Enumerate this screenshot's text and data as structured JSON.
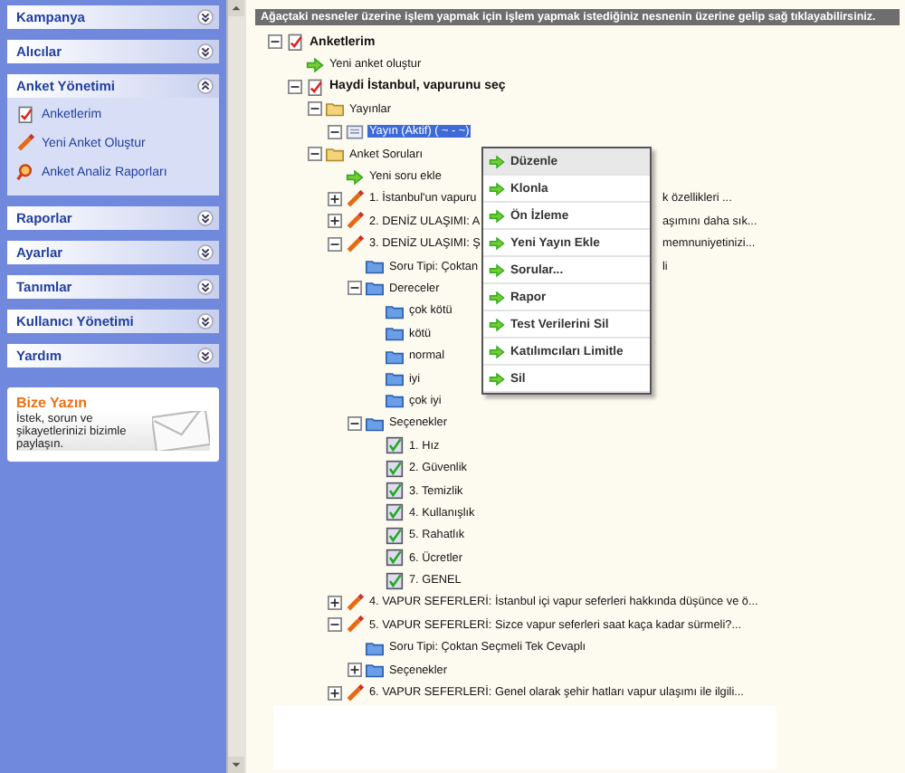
{
  "sidebar": {
    "sections": [
      {
        "title": "Kampanya",
        "expanded": false
      },
      {
        "title": "Alıcılar",
        "expanded": false
      },
      {
        "title": "Anket Yönetimi",
        "expanded": true,
        "items": [
          {
            "label": "Anketlerim",
            "kind": "survey"
          },
          {
            "label": "Yeni Anket Oluştur",
            "kind": "pencil"
          },
          {
            "label": "Anket Analiz Raporları",
            "kind": "report"
          }
        ]
      },
      {
        "title": "Raporlar",
        "expanded": false
      },
      {
        "title": "Ayarlar",
        "expanded": false
      },
      {
        "title": "Tanımlar",
        "expanded": false
      },
      {
        "title": "Kullanıcı Yönetimi",
        "expanded": false
      },
      {
        "title": "Yardım",
        "expanded": false
      }
    ],
    "contact": {
      "title": "Bize Yazın",
      "text": "İstek, sorun ve şikayetlerinizi bizimle paylaşın."
    }
  },
  "info_bar": "Ağaçtaki nesneler üzerine işlem yapmak için işlem yapmak istediğiniz nesnenin üzerine gelip sağ tıklayabilirsiniz.",
  "tree": [
    {
      "text": "Anketlerim",
      "kind": "survey",
      "expanded": true,
      "selected": false,
      "children": [
        {
          "text": "Yeni anket oluştur",
          "kind": "action",
          "selected": false
        },
        {
          "text": "Haydi İstanbul, vapurunu seç",
          "kind": "survey",
          "expanded": true,
          "selected": false,
          "children": [
            {
              "text": "Yayınlar",
              "kind": "yellow-folder",
              "expanded": true,
              "selected": false,
              "children": [
                {
                  "text": "Yayın (Aktif) ( ~ - ~)",
                  "kind": "document",
                  "expanded": true,
                  "selected": true
                }
              ]
            },
            {
              "text": "Anket Soruları",
              "kind": "yellow-folder",
              "expanded": true,
              "selected": false,
              "children": [
                {
                  "text": "Yeni soru ekle",
                  "kind": "action",
                  "selected": false
                },
                {
                  "text": "1. İstanbul'un vapuru",
                  "text_after": "k özellikleri ...",
                  "kind": "question",
                  "expanded": false,
                  "selected": false
                },
                {
                  "text": "2. DENİZ ULAŞIMI: A",
                  "text_after": "aşımını daha sık...",
                  "kind": "question",
                  "expanded": false,
                  "selected": false
                },
                {
                  "text": "3. DENİZ ULAŞIMI: Ş",
                  "text_after": "memnuniyetinizi...",
                  "kind": "question",
                  "expanded": true,
                  "selected": false,
                  "children": [
                    {
                      "text": "Soru Tipi: Çoktan",
                      "text_after": "li",
                      "kind": "folder",
                      "selected": false
                    },
                    {
                      "text": "Dereceler",
                      "kind": "folder",
                      "expanded": true,
                      "selected": false,
                      "children": [
                        {
                          "text": "çok kötü",
                          "kind": "folder",
                          "selected": false
                        },
                        {
                          "text": "kötü",
                          "kind": "folder",
                          "selected": false
                        },
                        {
                          "text": "normal",
                          "kind": "folder",
                          "selected": false
                        },
                        {
                          "text": "iyi",
                          "kind": "folder",
                          "selected": false
                        },
                        {
                          "text": "çok iyi",
                          "kind": "folder",
                          "selected": false
                        }
                      ]
                    },
                    {
                      "text": "Seçenekler",
                      "kind": "folder",
                      "expanded": true,
                      "selected": false,
                      "children": [
                        {
                          "text": "1. Hız",
                          "kind": "check",
                          "selected": false
                        },
                        {
                          "text": "2. Güvenlik",
                          "kind": "check",
                          "selected": false
                        },
                        {
                          "text": "3. Temizlik",
                          "kind": "check",
                          "selected": false
                        },
                        {
                          "text": "4. Kullanışlık",
                          "kind": "check",
                          "selected": false
                        },
                        {
                          "text": "5. Rahatlık",
                          "kind": "check",
                          "selected": false
                        },
                        {
                          "text": "6. Ücretler",
                          "kind": "check",
                          "selected": false
                        },
                        {
                          "text": "7. GENEL",
                          "kind": "check",
                          "selected": false
                        }
                      ]
                    }
                  ]
                },
                {
                  "text": "4. VAPUR SEFERLERİ: İstanbul içi vapur seferleri hakkında düşünce ve ö...",
                  "kind": "question",
                  "expanded": false,
                  "selected": false
                },
                {
                  "text": "5. VAPUR SEFERLERİ: Sizce vapur seferleri saat kaça kadar sürmeli?...",
                  "kind": "question",
                  "expanded": true,
                  "selected": false,
                  "children": [
                    {
                      "text": "Soru Tipi: Çoktan Seçmeli Tek Cevaplı",
                      "kind": "folder",
                      "selected": false
                    },
                    {
                      "text": "Seçenekler",
                      "kind": "folder",
                      "expanded": false,
                      "selected": false
                    }
                  ]
                },
                {
                  "text": "6. VAPUR SEFERLERİ: Genel olarak şehir hatları vapur ulaşımı ile ilgili...",
                  "kind": "question",
                  "expanded": false,
                  "selected": false
                }
              ]
            }
          ]
        }
      ]
    }
  ],
  "context_menu": [
    {
      "label": "Düzenle",
      "highlighted": true
    },
    {
      "label": "Klonla",
      "highlighted": false
    },
    {
      "label": "Ön İzleme",
      "highlighted": false
    },
    {
      "label": "Yeni Yayın Ekle",
      "highlighted": false
    },
    {
      "label": "Sorular...",
      "highlighted": false
    },
    {
      "label": "Rapor",
      "highlighted": false
    },
    {
      "label": "Test Verilerini Sil",
      "highlighted": false
    },
    {
      "label": "Katılımcıları Limitle",
      "highlighted": false
    },
    {
      "label": "Sil",
      "highlighted": false
    }
  ]
}
